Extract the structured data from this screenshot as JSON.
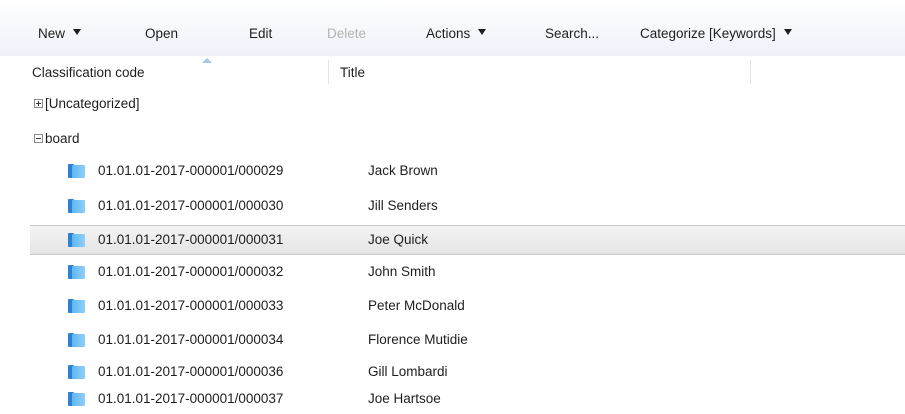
{
  "toolbar": {
    "new_label": "New",
    "open_label": "Open",
    "edit_label": "Edit",
    "delete_label": "Delete",
    "actions_label": "Actions",
    "search_label": "Search...",
    "categorize_label": "Categorize [Keywords]"
  },
  "columns": {
    "classification_code": "Classification code",
    "title": "Title",
    "sort_indicator": "ascending"
  },
  "groups": [
    {
      "label": "[Uncategorized]",
      "expanded": false,
      "icon": "expand-plus-icon"
    },
    {
      "label": "board",
      "expanded": true,
      "icon": "collapse-minus-icon"
    }
  ],
  "rows": [
    {
      "code": "01.01.01-2017-000001/000029",
      "title": "Jack Brown",
      "selected": false,
      "icon": "folder-icon"
    },
    {
      "code": "01.01.01-2017-000001/000030",
      "title": "Jill Senders",
      "selected": false,
      "icon": "folder-icon"
    },
    {
      "code": "01.01.01-2017-000001/000031",
      "title": "Joe Quick",
      "selected": true,
      "icon": "folder-icon"
    },
    {
      "code": "01.01.01-2017-000001/000032",
      "title": "John Smith",
      "selected": false,
      "icon": "folder-icon"
    },
    {
      "code": "01.01.01-2017-000001/000033",
      "title": "Peter McDonald",
      "selected": false,
      "icon": "folder-icon"
    },
    {
      "code": "01.01.01-2017-000001/000034",
      "title": "Florence Mutidie",
      "selected": false,
      "icon": "folder-icon"
    },
    {
      "code": "01.01.01-2017-000001/000036",
      "title": "Gill Lombardi",
      "selected": false,
      "icon": "folder-icon"
    },
    {
      "code": "01.01.01-2017-000001/000037",
      "title": "Joe Hartsoe",
      "selected": false,
      "icon": "folder-icon"
    }
  ],
  "colors": {
    "folder_blue": "#5fb6f2",
    "selection_gray": "#e4e4e4",
    "disabled_text": "#b3b3b3"
  }
}
